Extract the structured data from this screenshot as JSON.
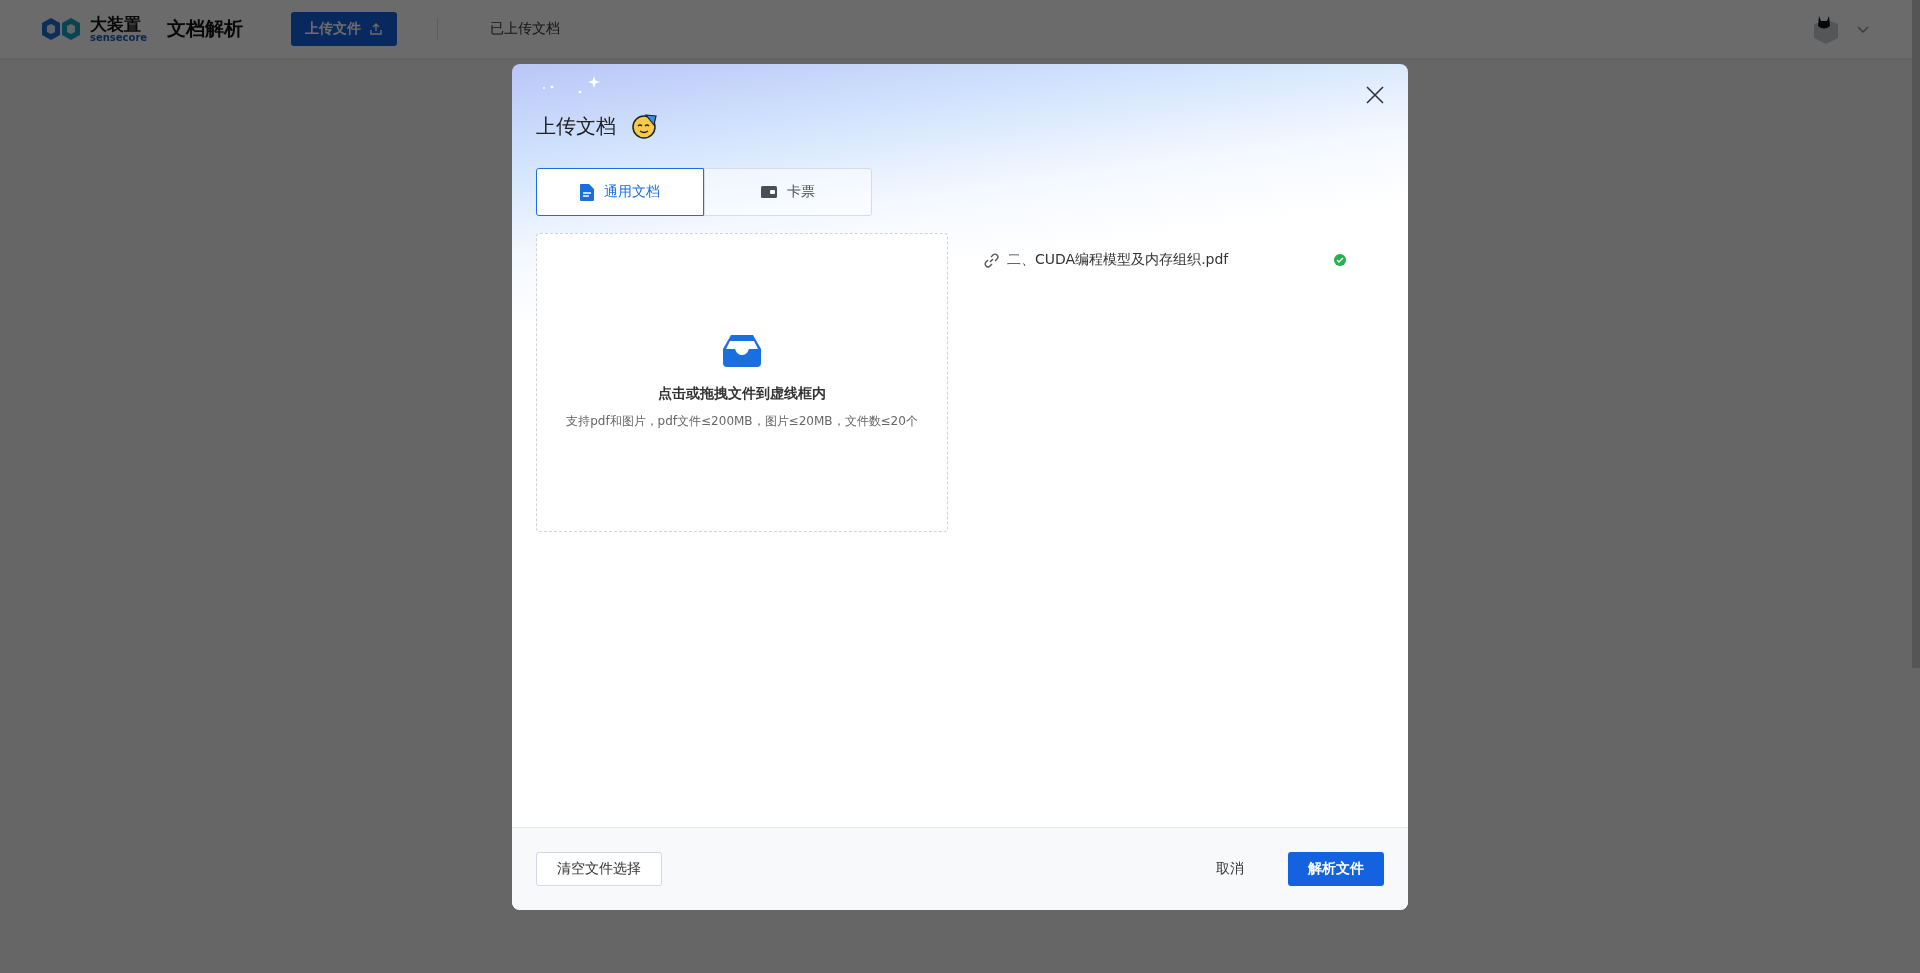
{
  "header": {
    "logo": {
      "name": "大装置",
      "sub": "sensecore"
    },
    "app_title": "文档解析",
    "upload_button": "上传文件",
    "nav_link": "已上传文档"
  },
  "dialog": {
    "title": "上传文档",
    "tabs": [
      {
        "label": "通用文档",
        "kind": "document",
        "selected": true
      },
      {
        "label": "卡票",
        "kind": "card",
        "selected": false
      }
    ],
    "dropzone": {
      "prompt": "点击或拖拽文件到虚线框内",
      "hint": "支持pdf和图片，pdf文件≤200MB，图片≤20MB，文件数≤20个"
    },
    "files": [
      {
        "name": "二、CUDA编程模型及内存组织.pdf",
        "uploaded": true
      }
    ],
    "footer": {
      "clear_button": "清空文件选择",
      "cancel_button": "取消",
      "submit_button": "解析文件"
    }
  }
}
